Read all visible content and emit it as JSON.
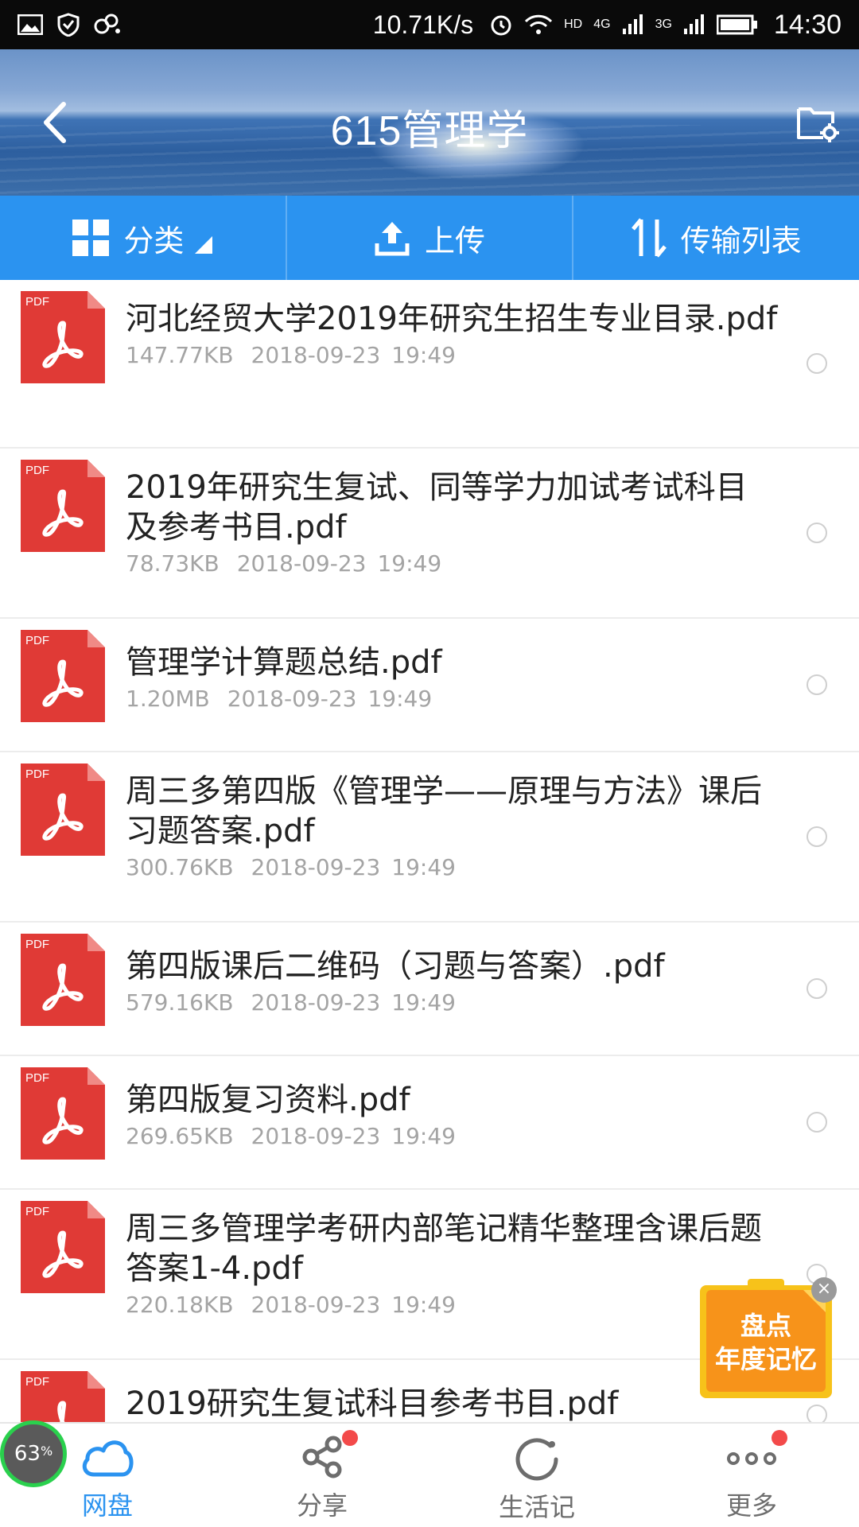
{
  "status_bar": {
    "speed": "10.71K/s",
    "network_1": "4G",
    "network_2": "3G",
    "time": "14:30",
    "hd": "HD"
  },
  "header": {
    "title": "615管理学"
  },
  "toolbar": {
    "category_label": "分类",
    "upload_label": "上传",
    "transfer_label": "传输列表"
  },
  "files": [
    {
      "name": "河北经贸大学2019年研究生招生专业目录.pdf",
      "size": "147.77KB",
      "date": "2018-09-23",
      "time": "19:49",
      "icon_text": "PDF"
    },
    {
      "name": "2019年研究生复试、同等学力加试考试科目及参考书目.pdf",
      "size": "78.73KB",
      "date": "2018-09-23",
      "time": "19:49",
      "icon_text": "PDF"
    },
    {
      "name": "管理学计算题总结.pdf",
      "size": "1.20MB",
      "date": "2018-09-23",
      "time": "19:49",
      "icon_text": "PDF"
    },
    {
      "name": "周三多第四版《管理学——原理与方法》课后习题答案.pdf",
      "size": "300.76KB",
      "date": "2018-09-23",
      "time": "19:49",
      "icon_text": "PDF"
    },
    {
      "name": "第四版课后二维码（习题与答案）.pdf",
      "size": "579.16KB",
      "date": "2018-09-23",
      "time": "19:49",
      "icon_text": "PDF"
    },
    {
      "name": "第四版复习资料.pdf",
      "size": "269.65KB",
      "date": "2018-09-23",
      "time": "19:49",
      "icon_text": "PDF"
    },
    {
      "name": "周三多管理学考研内部笔记精华整理含课后题答案1-4.pdf",
      "size": "220.18KB",
      "date": "2018-09-23",
      "time": "19:49",
      "icon_text": "PDF"
    },
    {
      "name": "2019研究生复试科目参考书目.pdf",
      "size": "",
      "date": "",
      "time": "",
      "icon_text": "PDF"
    }
  ],
  "promo": {
    "line1": "盘点",
    "line2": "年度记忆",
    "close": "×"
  },
  "progress_badge": {
    "value": "63",
    "unit": "%"
  },
  "bottom_nav": {
    "items": [
      {
        "label": "网盘",
        "icon": "cloud-icon",
        "active": true
      },
      {
        "label": "分享",
        "icon": "share-icon",
        "active": false
      },
      {
        "label": "生活记",
        "icon": "life-record-icon",
        "active": false
      },
      {
        "label": "更多",
        "icon": "more-icon",
        "active": false
      }
    ]
  },
  "colors": {
    "accent": "#2b93f0",
    "pdf_red": "#e03a36",
    "badge_red": "#f34a4a",
    "promo_orange": "#f7a21a"
  }
}
